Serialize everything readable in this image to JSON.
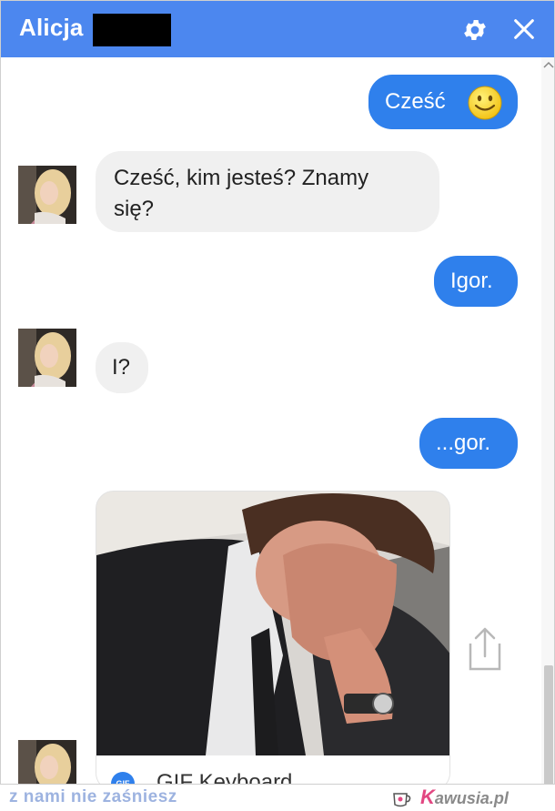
{
  "header": {
    "title": "Alicja",
    "gear_icon": "gear-icon",
    "close_icon": "close-icon",
    "color": "#4c87ef"
  },
  "messages": [
    {
      "side": "outgoing",
      "text": "Cześć",
      "emoji": "smiling-face-emoji"
    },
    {
      "side": "incoming",
      "text_line1": "Cześć, kim jesteś? Znamy",
      "text_line2": "się?"
    },
    {
      "side": "outgoing",
      "text": "Igor."
    },
    {
      "side": "incoming",
      "text": "I?"
    },
    {
      "side": "outgoing",
      "text": "...gor."
    },
    {
      "side": "incoming",
      "type": "gif",
      "source": "GIF Keyboard",
      "logo_text": "GIF"
    }
  ],
  "colors": {
    "outgoing_bubble": "#2f80ec",
    "incoming_bubble": "#f0f0f0"
  },
  "footer": {
    "slogan": "z nami nie zaśniesz",
    "brand_first": "K",
    "brand_rest": "awusia.pl"
  }
}
